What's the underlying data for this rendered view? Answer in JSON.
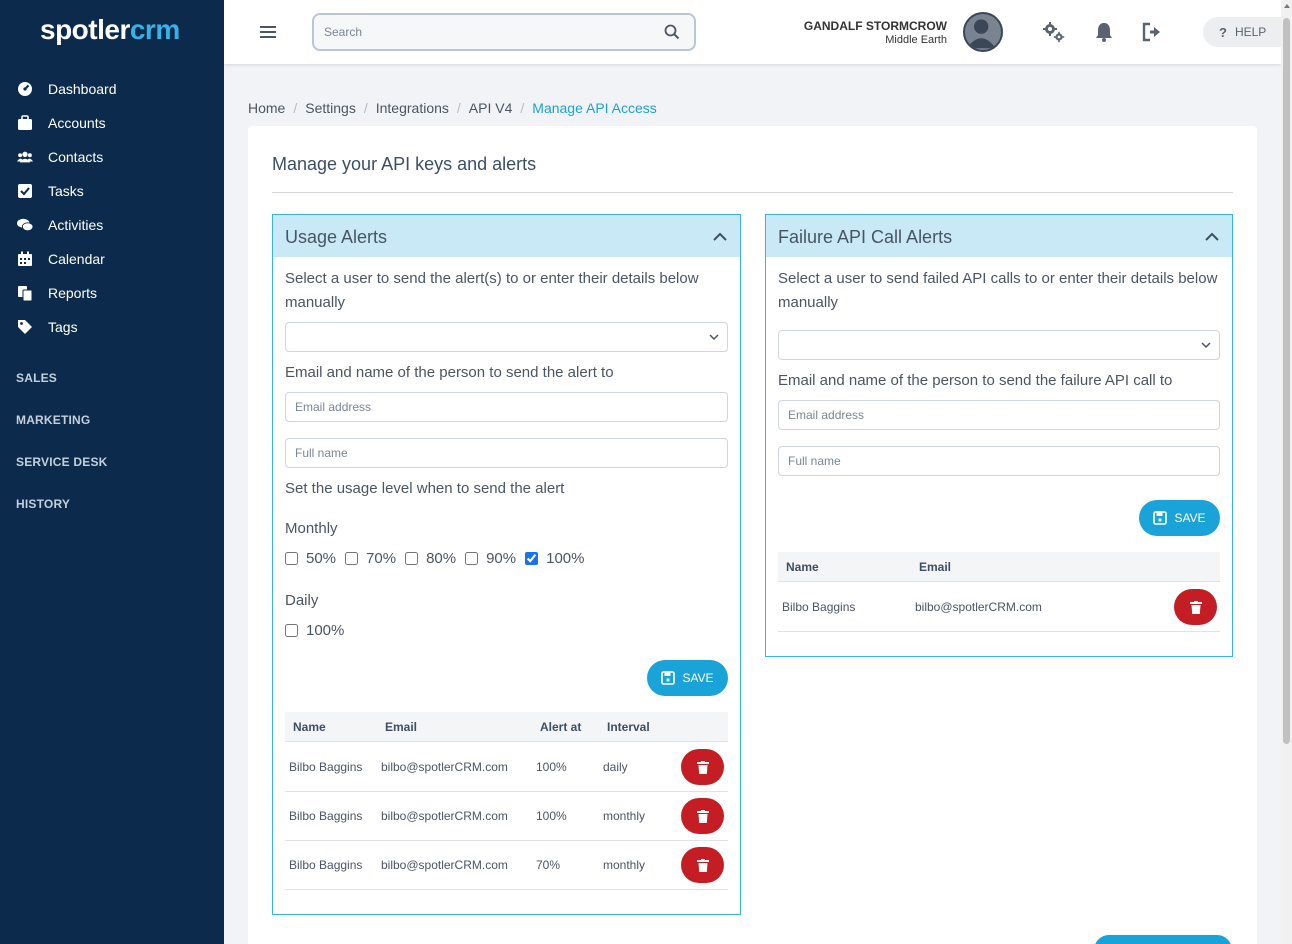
{
  "brand": {
    "part1": "spotler",
    "part2": "crm"
  },
  "sidebar": {
    "items": [
      {
        "label": "Dashboard",
        "icon": "dashboard-icon"
      },
      {
        "label": "Accounts",
        "icon": "briefcase-icon"
      },
      {
        "label": "Contacts",
        "icon": "users-icon"
      },
      {
        "label": "Tasks",
        "icon": "check-square-icon"
      },
      {
        "label": "Activities",
        "icon": "comments-icon"
      },
      {
        "label": "Calendar",
        "icon": "calendar-icon"
      },
      {
        "label": "Reports",
        "icon": "copy-icon"
      },
      {
        "label": "Tags",
        "icon": "tags-icon"
      }
    ],
    "sections": [
      "SALES",
      "MARKETING",
      "SERVICE DESK",
      "HISTORY"
    ]
  },
  "topbar": {
    "search_placeholder": "Search",
    "user_name": "GANDALF STORMCROW",
    "user_location": "Middle Earth",
    "help_label": "HELP",
    "help_glyph": "?"
  },
  "breadcrumb": [
    "Home",
    "Settings",
    "Integrations",
    "API V4",
    "Manage API Access"
  ],
  "page": {
    "title": "Manage your API keys and alerts"
  },
  "usage": {
    "title": "Usage Alerts",
    "intro": "Select a user to send the alert(s) to or enter their details below manually",
    "email_label": "Email and name of the person to send the alert to",
    "email_placeholder": "Email address",
    "name_placeholder": "Full name",
    "level_label": "Set the usage level when to send the alert",
    "monthly_label": "Monthly",
    "monthly_options": [
      {
        "label": "50%",
        "checked": false
      },
      {
        "label": "70%",
        "checked": false
      },
      {
        "label": "80%",
        "checked": false
      },
      {
        "label": "90%",
        "checked": false
      },
      {
        "label": "100%",
        "checked": true
      }
    ],
    "daily_label": "Daily",
    "daily_options": [
      {
        "label": "100%",
        "checked": false
      }
    ],
    "save_label": "SAVE",
    "columns": [
      "Name",
      "Email",
      "Alert at",
      "Interval"
    ],
    "rows": [
      {
        "name": "Bilbo Baggins",
        "email": "bilbo@spotlerCRM.com",
        "alert": "100%",
        "interval": "daily"
      },
      {
        "name": "Bilbo Baggins",
        "email": "bilbo@spotlerCRM.com",
        "alert": "100%",
        "interval": "monthly"
      },
      {
        "name": "Bilbo Baggins",
        "email": "bilbo@spotlerCRM.com",
        "alert": "70%",
        "interval": "monthly"
      }
    ]
  },
  "failure": {
    "title": "Failure API Call Alerts",
    "intro": "Select a user to send failed API calls to or enter their details below manually",
    "email_label": "Email and name of the person to send the failure API call to",
    "email_placeholder": "Email address",
    "name_placeholder": "Full name",
    "save_label": "SAVE",
    "columns": [
      "Name",
      "Email"
    ],
    "rows": [
      {
        "name": "Bilbo Baggins",
        "email": "bilbo@spotlerCRM.com"
      }
    ]
  },
  "colors": {
    "sidebar_bg": "#0c2a4c",
    "accent": "#1aa3d8",
    "panel_header": "#c9e9f7",
    "delete": "#c41e24"
  }
}
